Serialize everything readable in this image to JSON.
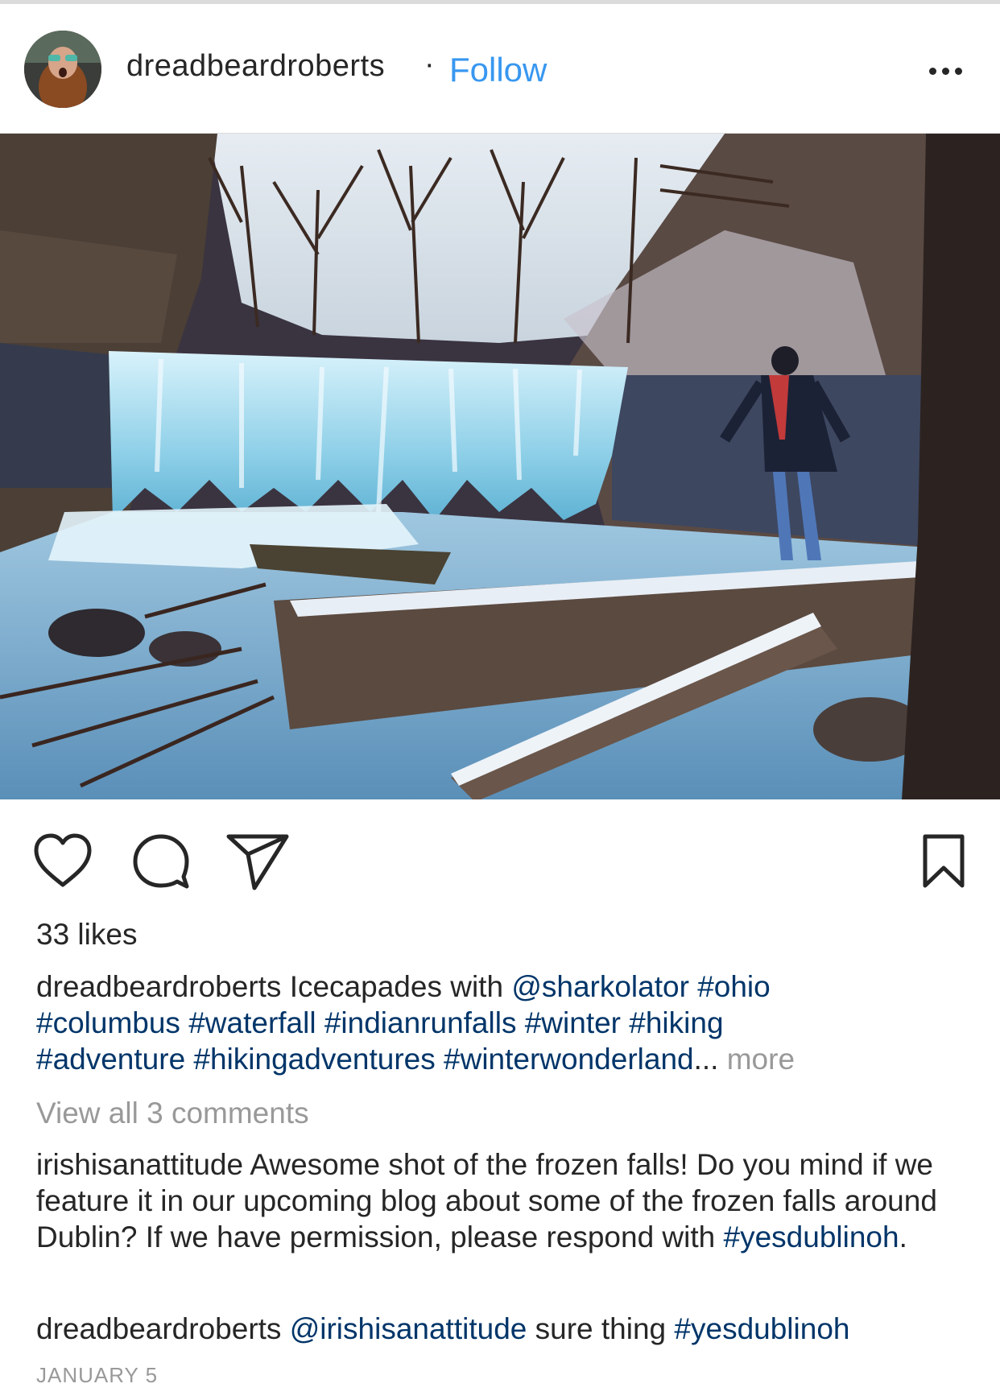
{
  "post": {
    "author": "dreadbeardroberts",
    "separator": "·",
    "follow_label": "Follow",
    "more_icon": "more-options-icon",
    "photo_alt": "frozen-waterfall-photo"
  },
  "actions": {
    "like_icon": "heart-icon",
    "comment_icon": "comment-bubble-icon",
    "share_icon": "send-icon",
    "save_icon": "bookmark-icon"
  },
  "likes": "33 likes",
  "caption": {
    "user": "dreadbeardroberts",
    "text": "Icecapades with",
    "mention": "@sharkolator",
    "tags_line1": "#ohio",
    "tags_line2": "#columbus #waterfall #indianrunfalls #winter #hiking",
    "tags_line3": "#adventure #hikingadventures #winterwonderland",
    "ellipsis": "...",
    "more_label": "more"
  },
  "view_comments": "View all 3 comments",
  "comments": [
    {
      "user": "irishisanattitude",
      "text": "Awesome shot of the frozen falls! Do you mind if we feature it in our upcoming blog about some of the frozen falls around Dublin? If we have permission, please respond with",
      "tag": "#yesdublinoh",
      "end": "."
    },
    {
      "user": "dreadbeardroberts",
      "mention": "@irishisanattitude",
      "text": "sure thing",
      "tag": "#yesdublinoh"
    }
  ],
  "date": "JANUARY 5",
  "colors": {
    "follow": "#3897f0",
    "link": "#003569",
    "muted": "#999999",
    "text": "#262626"
  }
}
